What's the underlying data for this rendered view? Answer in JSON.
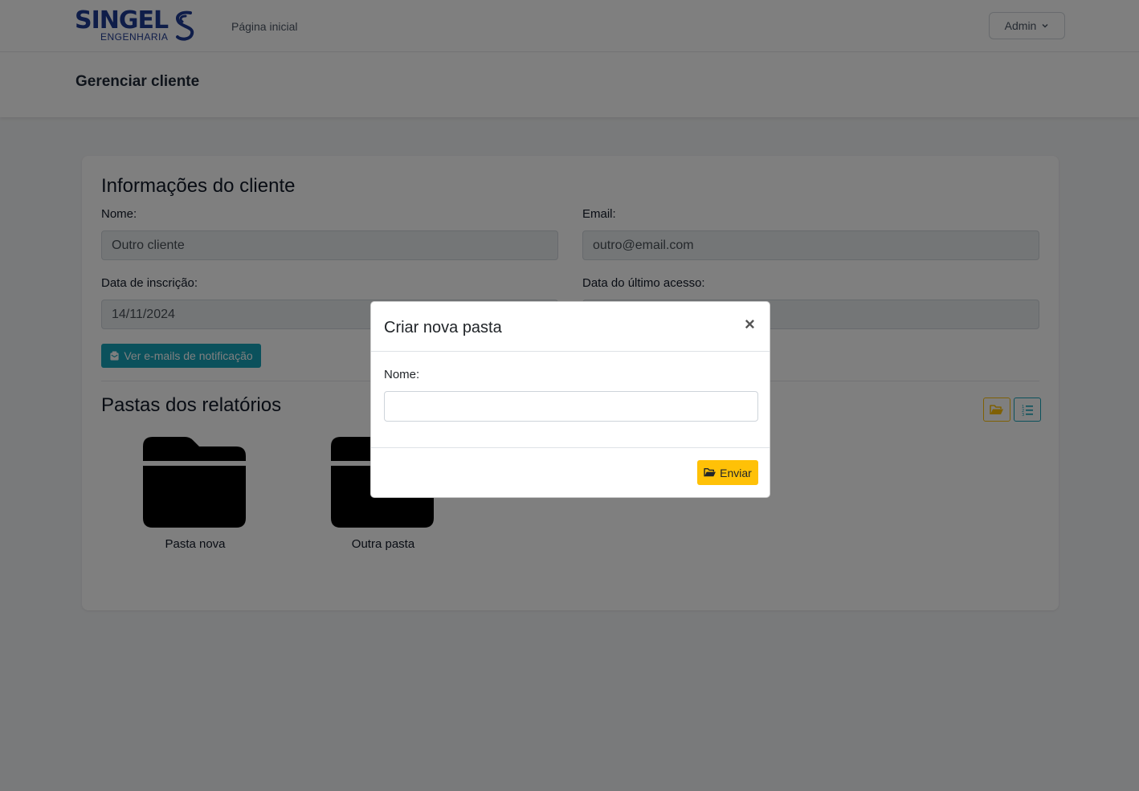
{
  "nav": {
    "logo_word": "SINGEL",
    "logo_sub": "ENGENHARIA",
    "home_link": "Página inicial",
    "user_menu": "Admin"
  },
  "header": {
    "title": "Gerenciar cliente"
  },
  "client": {
    "section_title": "Informações do cliente",
    "name_label": "Nome:",
    "name_value": "Outro cliente",
    "email_label": "Email:",
    "email_value": "outro@email.com",
    "signup_label": "Data de inscrição:",
    "signup_value": "14/11/2024",
    "last_access_label": "Data do último acesso:",
    "last_access_value": "",
    "notifications_button": "Ver e-mails de notificação"
  },
  "folders": {
    "section_title": "Pastas dos relatórios",
    "items": [
      {
        "name": "Pasta nova"
      },
      {
        "name": "Outra pasta"
      }
    ],
    "actions": {
      "new_folder_icon": "folder-open-icon",
      "list_view_icon": "list-ol-icon"
    }
  },
  "modal": {
    "title": "Criar nova pasta",
    "close": "×",
    "name_label": "Nome:",
    "name_value": "",
    "submit_label": "Enviar"
  },
  "colors": {
    "brand": "#1f3a93",
    "info": "#17a2b8",
    "warning": "#ffc107",
    "backdrop": "rgba(0,0,0,0.5)"
  }
}
